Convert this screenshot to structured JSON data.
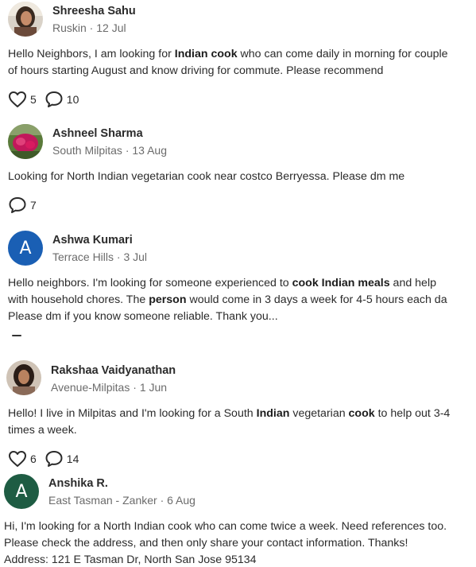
{
  "posts": [
    {
      "author": "Shreesha Sahu",
      "neighborhood": "Ruskin",
      "date": "12 Jul",
      "avatar": "photo",
      "lines": [
        [
          {
            "t": "Hello Neighbors, I am looking for "
          },
          {
            "t": "Indian cook",
            "b": true
          },
          {
            "t": " who can come daily in morning for couple"
          }
        ],
        [
          {
            "t": "of hours starting August  and know driving for commute. Please recommend"
          }
        ]
      ],
      "likes": "5",
      "comments": "10"
    },
    {
      "author": "Ashneel Sharma",
      "neighborhood": "South Milpitas",
      "date": "13 Aug",
      "avatar": "photo",
      "lines": [
        [
          {
            "t": "Looking for North Indian vegetarian cook near costco Berryessa. Please dm me"
          }
        ]
      ],
      "comments": "7"
    },
    {
      "author": "Ashwa Kumari",
      "neighborhood": "Terrace  Hills",
      "date": "3 Jul",
      "avatar": "A",
      "avatar_color": "#1a5fb4",
      "lines": [
        [
          {
            "t": "Hello neighbors. I'm looking for someone experienced to "
          },
          {
            "t": "cook Indian meals",
            "b": true
          },
          {
            "t": " and help"
          }
        ],
        [
          {
            "t": "with household chores. The "
          },
          {
            "t": "person",
            "b": true
          },
          {
            "t": " would come in 3 days a week for 4-5 hours each da"
          }
        ],
        [
          {
            "t": "Please dm if you know someone reliable. Thank you..."
          }
        ]
      ]
    },
    {
      "author": "Rakshaa Vaidyanathan",
      "neighborhood": "Avenue-Milpitas",
      "date": "1 Jun",
      "avatar": "photo",
      "lines": [
        [
          {
            "t": "Hello! I live in Milpitas and I'm looking for a South "
          },
          {
            "t": "Indian",
            "b": true
          },
          {
            "t": " vegetarian "
          },
          {
            "t": "cook",
            "b": true
          },
          {
            "t": " to help out 3-4"
          }
        ],
        [
          {
            "t": "times a week."
          }
        ]
      ],
      "likes": "6",
      "comments": "14"
    },
    {
      "author": "Anshika R.",
      "neighborhood": "East Tasman - Zanker",
      "date": "6 Aug",
      "avatar": "A",
      "avatar_color": "#1e5c43",
      "lines": [
        [
          {
            "t": "Hi, I'm looking for a North Indian cook who can come twice a week. Need references too."
          }
        ],
        [
          {
            "t": "Please check the address, and then only share your contact information. Thanks!"
          }
        ],
        [
          {
            "t": "Address: 121 E Tasman Dr, North San Jose 95134"
          }
        ]
      ]
    }
  ],
  "icons": {
    "like": "heart-outline-icon",
    "comment": "speech-bubble-icon"
  },
  "colors": {
    "text": "#2b2b2b",
    "meta": "#6b6b6b",
    "avatar_blue": "#1a5fb4",
    "avatar_green": "#1e5c43"
  }
}
